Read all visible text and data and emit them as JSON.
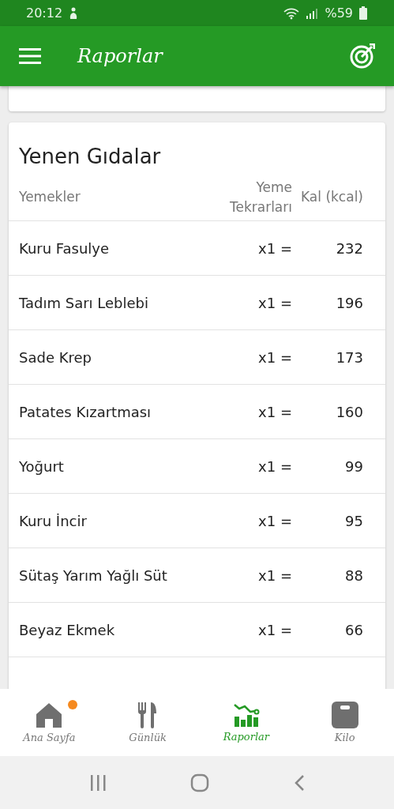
{
  "status_bar": {
    "time": "20:12",
    "battery": "%59"
  },
  "app_bar": {
    "title": "Raporlar"
  },
  "eaten_foods": {
    "title": "Yenen Gıdalar",
    "columns": [
      "Yemekler",
      "Yeme Tekrarları",
      "Kal (kcal)"
    ],
    "rows": [
      {
        "food": "Kuru Fasulye",
        "times": "x1 =",
        "kcal": "232"
      },
      {
        "food": "Tadım Sarı Leblebi",
        "times": "x1 =",
        "kcal": "196"
      },
      {
        "food": "Sade Krep",
        "times": "x1 =",
        "kcal": "173"
      },
      {
        "food": "Patates Kızartması",
        "times": "x1 =",
        "kcal": "160"
      },
      {
        "food": "Yoğurt",
        "times": "x1 =",
        "kcal": "99"
      },
      {
        "food": "Kuru İncir",
        "times": "x1 =",
        "kcal": "95"
      },
      {
        "food": "Sütaş Yarım Yağlı Süt",
        "times": "x1 =",
        "kcal": "88"
      },
      {
        "food": "Beyaz Ekmek",
        "times": "x1 =",
        "kcal": "66"
      }
    ]
  },
  "bottom_nav": [
    {
      "kind": "home",
      "label": "Ana Sayfa",
      "selected": false,
      "dot": true
    },
    {
      "kind": "diary",
      "label": "Günlük",
      "selected": false,
      "dot": false
    },
    {
      "kind": "reports",
      "label": "Raporlar",
      "selected": true,
      "dot": false
    },
    {
      "kind": "weight",
      "label": "Kilo",
      "selected": false,
      "dot": false
    }
  ]
}
